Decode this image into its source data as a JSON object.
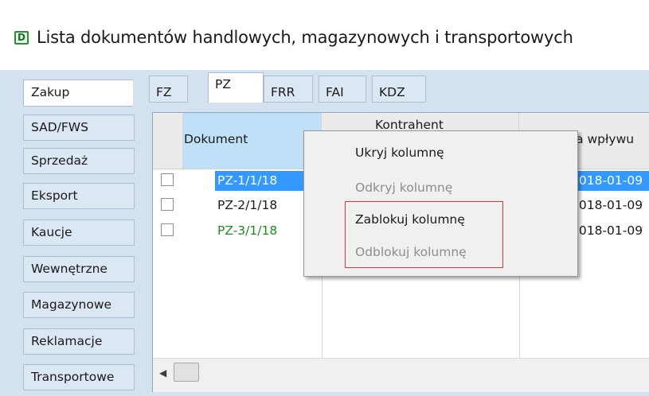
{
  "window": {
    "title": "Lista dokumentów handlowych, magazynowych i transportowych",
    "icon": "document-list-icon"
  },
  "sidebar": {
    "items": [
      {
        "label": "Zakup",
        "active": true
      },
      {
        "label": "SAD/FWS"
      },
      {
        "label": "Sprzedaż"
      },
      {
        "label": "Eksport"
      },
      {
        "label": "Kaucje"
      },
      {
        "label": "Wewnętrzne"
      },
      {
        "label": "Magazynowe"
      },
      {
        "label": "Reklamacje"
      },
      {
        "label": "Transportowe"
      }
    ]
  },
  "tabs": [
    {
      "label": "FZ"
    },
    {
      "label": "PZ",
      "active": true
    },
    {
      "label": "FRR"
    },
    {
      "label": "FAI"
    },
    {
      "label": "KDZ"
    }
  ],
  "grid": {
    "columns": [
      "Dokument",
      "Kontrahent",
      "ta wpływu"
    ],
    "rows": [
      {
        "document": "PZ-1/1/18",
        "date": "2018-01-09",
        "selected": true
      },
      {
        "document": "PZ-2/1/18",
        "date": "2018-01-09",
        "selected": false
      },
      {
        "document": "PZ-3/1/18",
        "date": "2018-01-09",
        "selected": false,
        "color": "#1e8c1e"
      }
    ]
  },
  "context_menu": {
    "items": [
      {
        "label": "Ukryj kolumnę",
        "enabled": true
      },
      {
        "label": "Odkryj kolumnę",
        "enabled": false
      },
      {
        "label": "Zablokuj kolumnę",
        "enabled": true
      },
      {
        "label": "Odblokuj kolumnę",
        "enabled": false
      }
    ],
    "highlight_color": "#d83a3a"
  },
  "colors": {
    "panel": "#d4e2f0",
    "selection": "#3399ff",
    "header_selected": "#bfe0f6"
  }
}
